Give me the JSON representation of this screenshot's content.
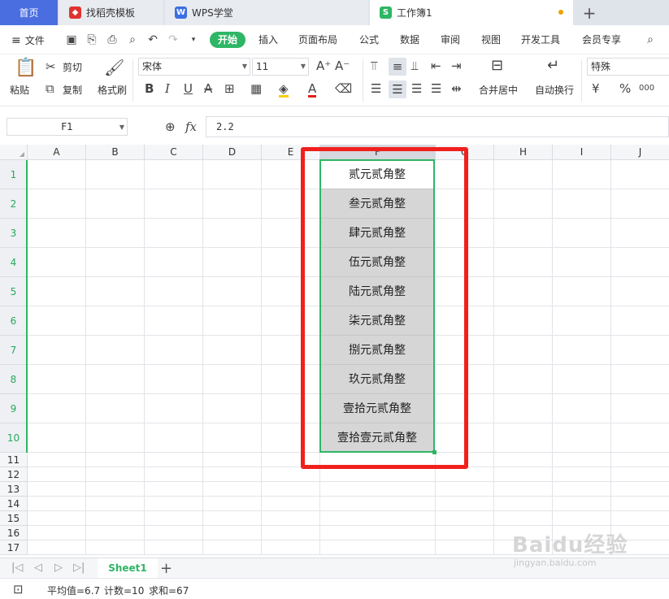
{
  "tabs": {
    "home": "首页",
    "template": "找稻壳模板",
    "wps_school": "WPS学堂",
    "workbook": "工作簿1"
  },
  "menu": {
    "file": "文件",
    "items": [
      "开始",
      "插入",
      "页面布局",
      "公式",
      "数据",
      "审阅",
      "视图",
      "开发工具",
      "会员专享"
    ],
    "active": "开始"
  },
  "ribbon": {
    "paste": "粘贴",
    "cut": "剪切",
    "copy": "复制",
    "format_painter": "格式刷",
    "font_name": "宋体",
    "font_size": "11",
    "merge_center": "合并居中",
    "wrap_text": "自动换行",
    "number_format": "特殊"
  },
  "formula_bar": {
    "name_box": "F1",
    "fx": "fx",
    "value": "2.2"
  },
  "grid": {
    "columns": [
      "A",
      "B",
      "C",
      "D",
      "E",
      "F",
      "G",
      "H",
      "I",
      "J"
    ],
    "rows": [
      "1",
      "2",
      "3",
      "4",
      "5",
      "6",
      "7",
      "8",
      "9",
      "10",
      "11",
      "12",
      "13",
      "14",
      "15",
      "16",
      "17"
    ],
    "selected_column": "F",
    "f_values": [
      "贰元贰角整",
      "叁元贰角整",
      "肆元贰角整",
      "伍元贰角整",
      "陆元贰角整",
      "柒元贰角整",
      "捌元贰角整",
      "玖元贰角整",
      "壹拾元贰角整",
      "壹拾壹元贰角整"
    ]
  },
  "sheet_tabs": {
    "active": "Sheet1",
    "add": "+"
  },
  "status": {
    "average": "平均值=6.7",
    "count": "计数=10",
    "sum": "求和=67"
  },
  "watermark": {
    "brand": "Baidu经验",
    "url": "jingyan.baidu.com"
  },
  "colors": {
    "accent": "#2eb665",
    "tab_home": "#4a6ee0",
    "highlight_box": "#f0201c",
    "selected_fill": "#d6d6d6"
  }
}
